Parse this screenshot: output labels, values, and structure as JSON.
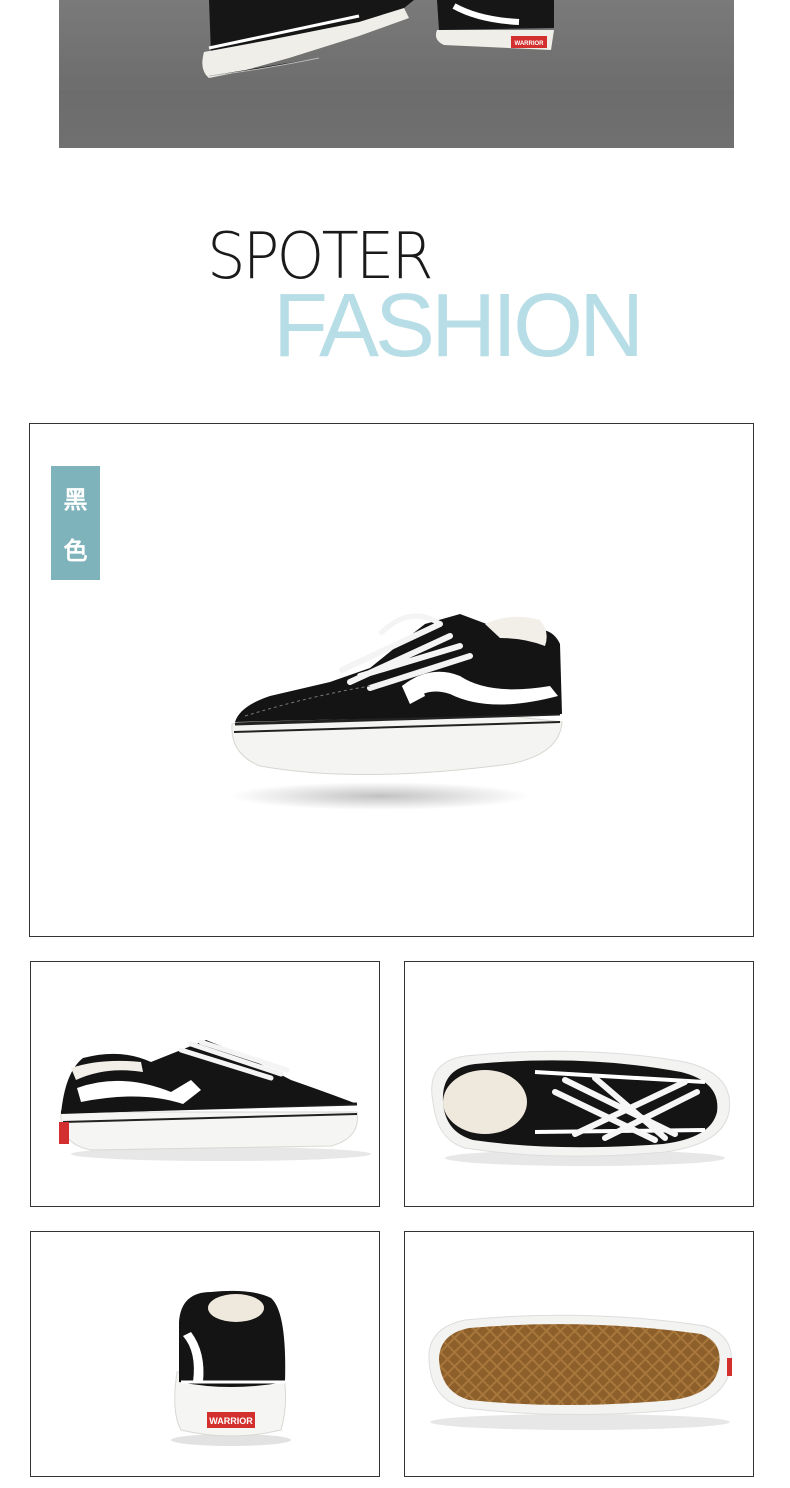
{
  "hero": {
    "brand_label": "WARRIOR"
  },
  "title": {
    "line1": "SPOTER",
    "line2": "FASHION"
  },
  "main_product": {
    "color_tag_chars": [
      "黑",
      "色"
    ]
  },
  "views": [
    {
      "name": "side"
    },
    {
      "name": "top"
    },
    {
      "name": "back",
      "heel_label": "WARRIOR"
    },
    {
      "name": "sole"
    }
  ],
  "colors": {
    "accent": "#7fb3bb",
    "fashion_text": "#b7dde6",
    "title_text": "#1a1a1a",
    "warrior_red": "#d32f2f"
  }
}
